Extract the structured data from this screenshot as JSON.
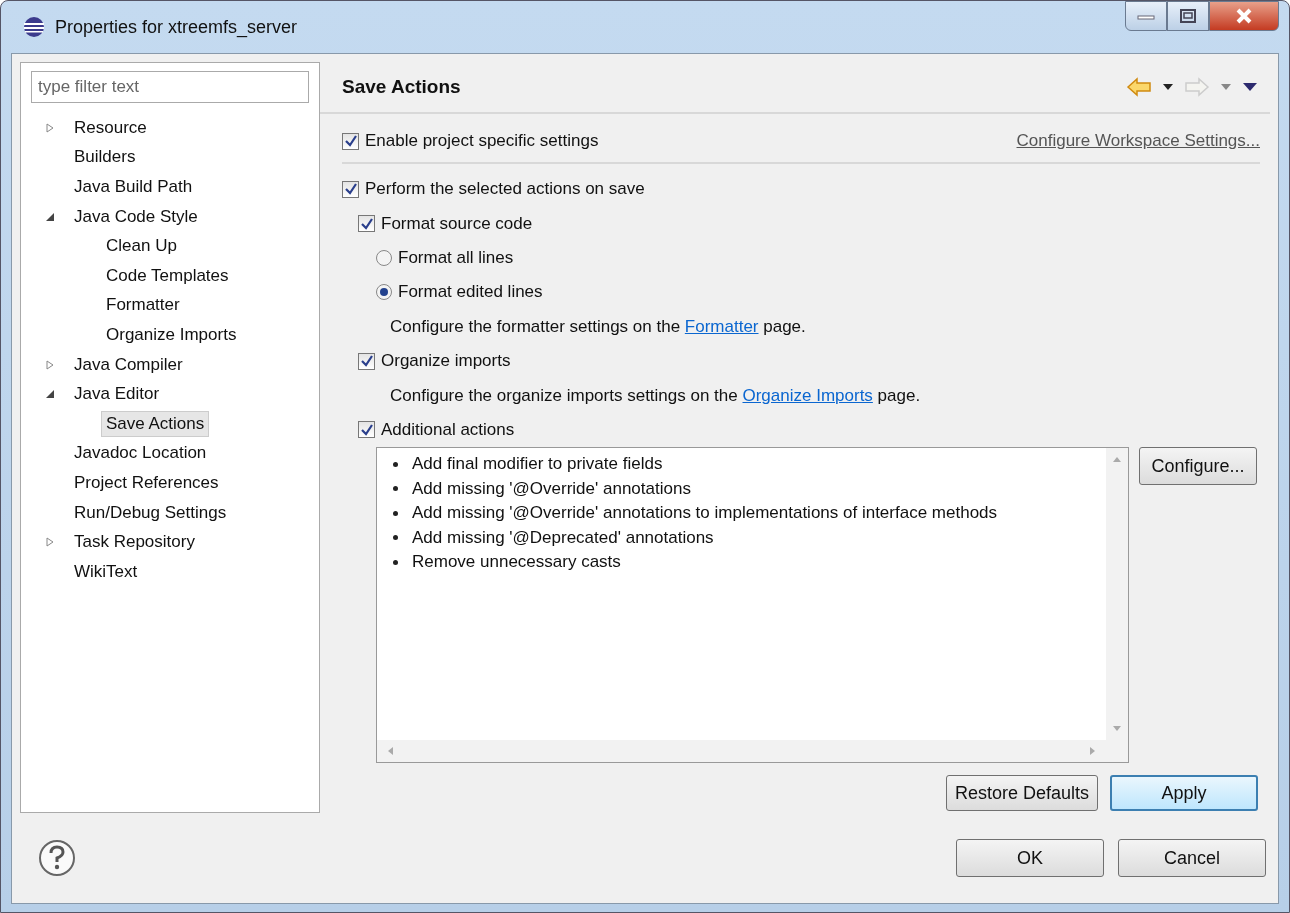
{
  "window": {
    "title": "Properties for xtreemfs_server"
  },
  "filter": {
    "placeholder": "type filter text"
  },
  "tree": [
    {
      "label": "Resource",
      "expanded": false,
      "selected": false
    },
    {
      "label": "Builders",
      "selected": false
    },
    {
      "label": "Java Build Path",
      "selected": false
    },
    {
      "label": "Java Code Style",
      "expanded": true,
      "selected": false,
      "children": [
        {
          "label": "Clean Up",
          "selected": false
        },
        {
          "label": "Code Templates",
          "selected": false
        },
        {
          "label": "Formatter",
          "selected": false
        },
        {
          "label": "Organize Imports",
          "selected": false
        }
      ]
    },
    {
      "label": "Java Compiler",
      "expanded": false,
      "selected": false
    },
    {
      "label": "Java Editor",
      "expanded": true,
      "selected": false,
      "children": [
        {
          "label": "Save Actions",
          "selected": true
        }
      ]
    },
    {
      "label": "Javadoc Location",
      "selected": false
    },
    {
      "label": "Project References",
      "selected": false
    },
    {
      "label": "Run/Debug Settings",
      "selected": false
    },
    {
      "label": "Task Repository",
      "expanded": false,
      "selected": false
    },
    {
      "label": "WikiText",
      "selected": false
    }
  ],
  "page": {
    "title": "Save Actions"
  },
  "project_specific": {
    "label": "Enable project specific settings",
    "checked": true
  },
  "workspace_link": "Configure Workspace Settings...",
  "options": [
    {
      "kind": "checkbox",
      "label": "Perform the selected actions on save",
      "checked": true,
      "children": [
        {
          "kind": "checkbox",
          "label": "Format source code",
          "checked": true,
          "children": [
            {
              "kind": "radio",
              "label": "Format all lines",
              "selected": false
            },
            {
              "kind": "radio",
              "label": "Format edited lines",
              "selected": true
            },
            {
              "kind": "note",
              "before": "Configure the formatter settings on the ",
              "link": "Formatter",
              "after": " page."
            }
          ]
        },
        {
          "kind": "checkbox",
          "label": "Organize imports",
          "checked": true,
          "children": [
            {
              "kind": "note",
              "before": "Configure the organize imports settings on the ",
              "link": "Organize Imports",
              "after": " page."
            }
          ]
        },
        {
          "kind": "checkbox",
          "label": "Additional actions",
          "checked": true
        }
      ]
    }
  ],
  "actions": [
    "Add final modifier to private fields",
    "Add missing '@Override' annotations",
    "Add missing '@Override' annotations to implementations of interface methods",
    "Add missing '@Deprecated' annotations",
    "Remove unnecessary casts"
  ],
  "configure_button": "Configure...",
  "page_buttons": [
    {
      "label": "Restore Defaults",
      "focused": false
    },
    {
      "label": "Apply",
      "focused": true
    }
  ],
  "dialog_buttons": [
    "OK",
    "Cancel"
  ]
}
